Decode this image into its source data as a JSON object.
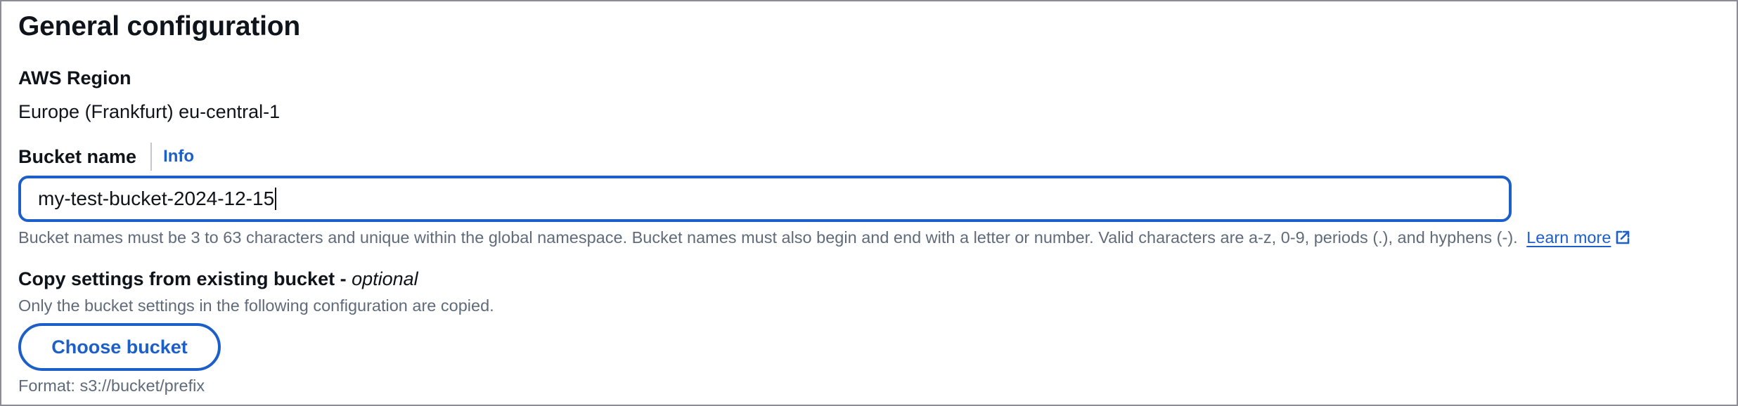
{
  "section": {
    "title": "General configuration"
  },
  "region": {
    "label": "AWS Region",
    "value": "Europe (Frankfurt) eu-central-1"
  },
  "bucket_name": {
    "label": "Bucket name",
    "info_link": "Info",
    "input_value": "my-test-bucket-2024-12-15",
    "hint": "Bucket names must be 3 to 63 characters and unique within the global namespace. Bucket names must also begin and end with a letter or number. Valid characters are a-z, 0-9, periods (.), and hyphens (-).",
    "learn_more": "Learn more",
    "learn_more_icon": "external-link-icon"
  },
  "copy_settings": {
    "label": "Copy settings from existing bucket - ",
    "optional": "optional",
    "description": "Only the bucket settings in the following configuration are copied.",
    "button_label": "Choose bucket",
    "format": "Format: s3://bucket/prefix"
  },
  "colors": {
    "link": "#1d5fc8",
    "text": "#0f141a",
    "secondary_text": "#5f6b7a",
    "border": "#8c8c94"
  }
}
